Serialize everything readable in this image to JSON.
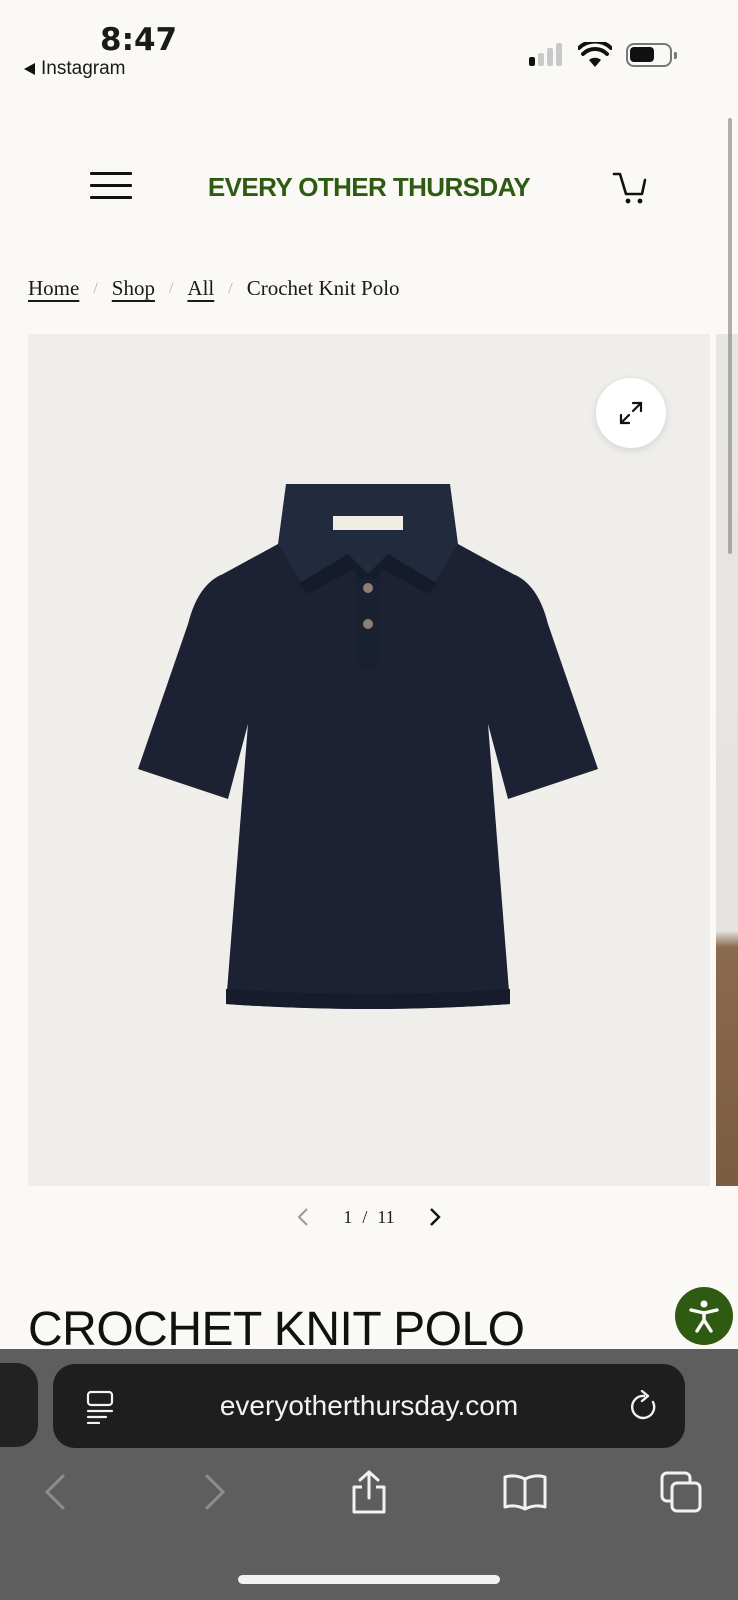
{
  "status": {
    "time": "8:47",
    "back_app": "Instagram"
  },
  "header": {
    "brand": "EVERY OTHER THURSDAY"
  },
  "breadcrumb": {
    "home": "Home",
    "shop": "Shop",
    "all": "All",
    "current": "Crochet Knit Polo",
    "separator": "/"
  },
  "gallery": {
    "current": "1",
    "separator": "/",
    "total": "11"
  },
  "product": {
    "title": "CROCHET KNIT POLO"
  },
  "browser": {
    "url": "everyotherthursday.com"
  },
  "colors": {
    "brand": "#2f5a12",
    "shirt": "#1c2233"
  },
  "icons": [
    "menu-icon",
    "cart-icon",
    "expand-icon",
    "chevron-left-icon",
    "chevron-right-icon",
    "accessibility-icon",
    "reader-icon",
    "reload-icon",
    "share-icon",
    "bookmarks-icon",
    "tabs-icon"
  ]
}
